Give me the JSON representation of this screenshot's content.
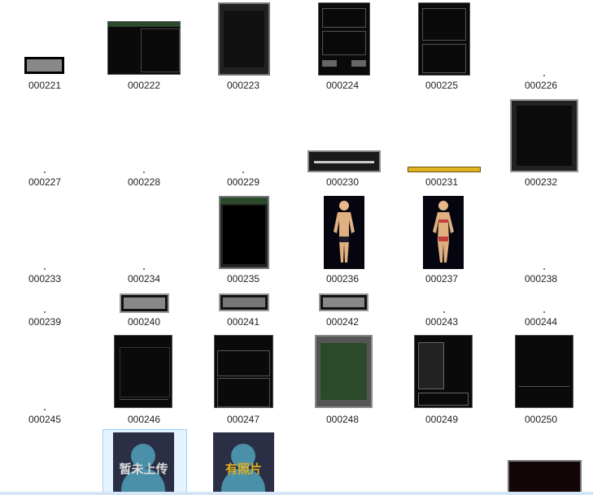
{
  "files": [
    {
      "name": "000221"
    },
    {
      "name": "000222"
    },
    {
      "name": "000223"
    },
    {
      "name": "000224"
    },
    {
      "name": "000225"
    },
    {
      "name": "000226"
    },
    {
      "name": "000227"
    },
    {
      "name": "000228"
    },
    {
      "name": "000229"
    },
    {
      "name": "000230"
    },
    {
      "name": "000231"
    },
    {
      "name": "000232"
    },
    {
      "name": "000233"
    },
    {
      "name": "000234"
    },
    {
      "name": "000235"
    },
    {
      "name": "000236"
    },
    {
      "name": "000237"
    },
    {
      "name": "000238"
    },
    {
      "name": "000239"
    },
    {
      "name": "000240"
    },
    {
      "name": "000241"
    },
    {
      "name": "000242"
    },
    {
      "name": "000243"
    },
    {
      "name": "000244"
    },
    {
      "name": "000245"
    },
    {
      "name": "000246"
    },
    {
      "name": "000247"
    },
    {
      "name": "000248"
    },
    {
      "name": "000249"
    },
    {
      "name": "000250"
    }
  ],
  "bottom_row": [
    {
      "caption": "暂未上传",
      "color": "#dddddd"
    },
    {
      "caption": "有照片",
      "color": "#e0b020"
    }
  ]
}
